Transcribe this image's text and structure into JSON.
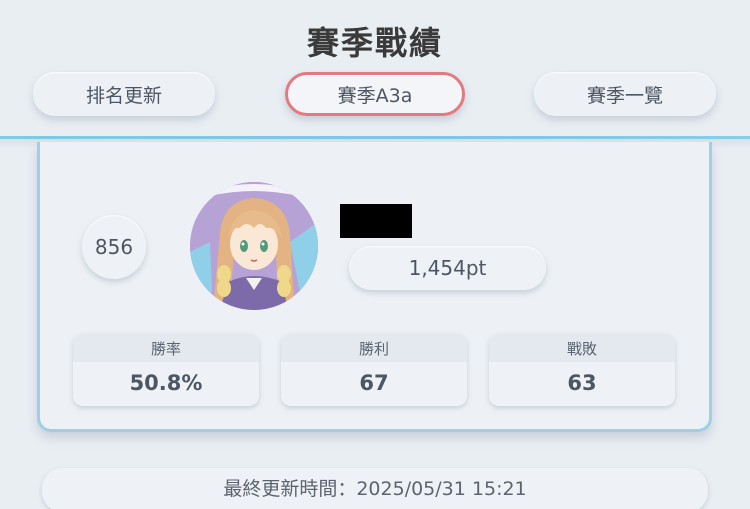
{
  "header": {
    "title": "賽季戰績",
    "tabs": [
      {
        "label": "排名更新"
      },
      {
        "label": "賽季A3a",
        "selected": true
      },
      {
        "label": "賽季一覽"
      }
    ]
  },
  "profile": {
    "rank": "856",
    "points": "1,454pt",
    "avatar_icon": "character-avatar"
  },
  "stats": [
    {
      "label": "勝率",
      "value": "50.8%"
    },
    {
      "label": "勝利",
      "value": "67"
    },
    {
      "label": "戰敗",
      "value": "63"
    }
  ],
  "footer": {
    "last_updated": "最終更新時間：2025/05/31 15:21"
  },
  "colors": {
    "accent_line": "#7fcbe3",
    "selected_tab_border": "#e47a7f",
    "background": "#e9eef3"
  }
}
